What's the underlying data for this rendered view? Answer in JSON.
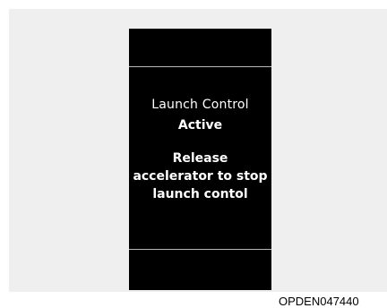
{
  "display": {
    "title": "Launch Control",
    "status": "Active",
    "instruction": "Release\naccelerator to stop\nlaunch contol"
  },
  "figure_code": "OPDEN047440"
}
